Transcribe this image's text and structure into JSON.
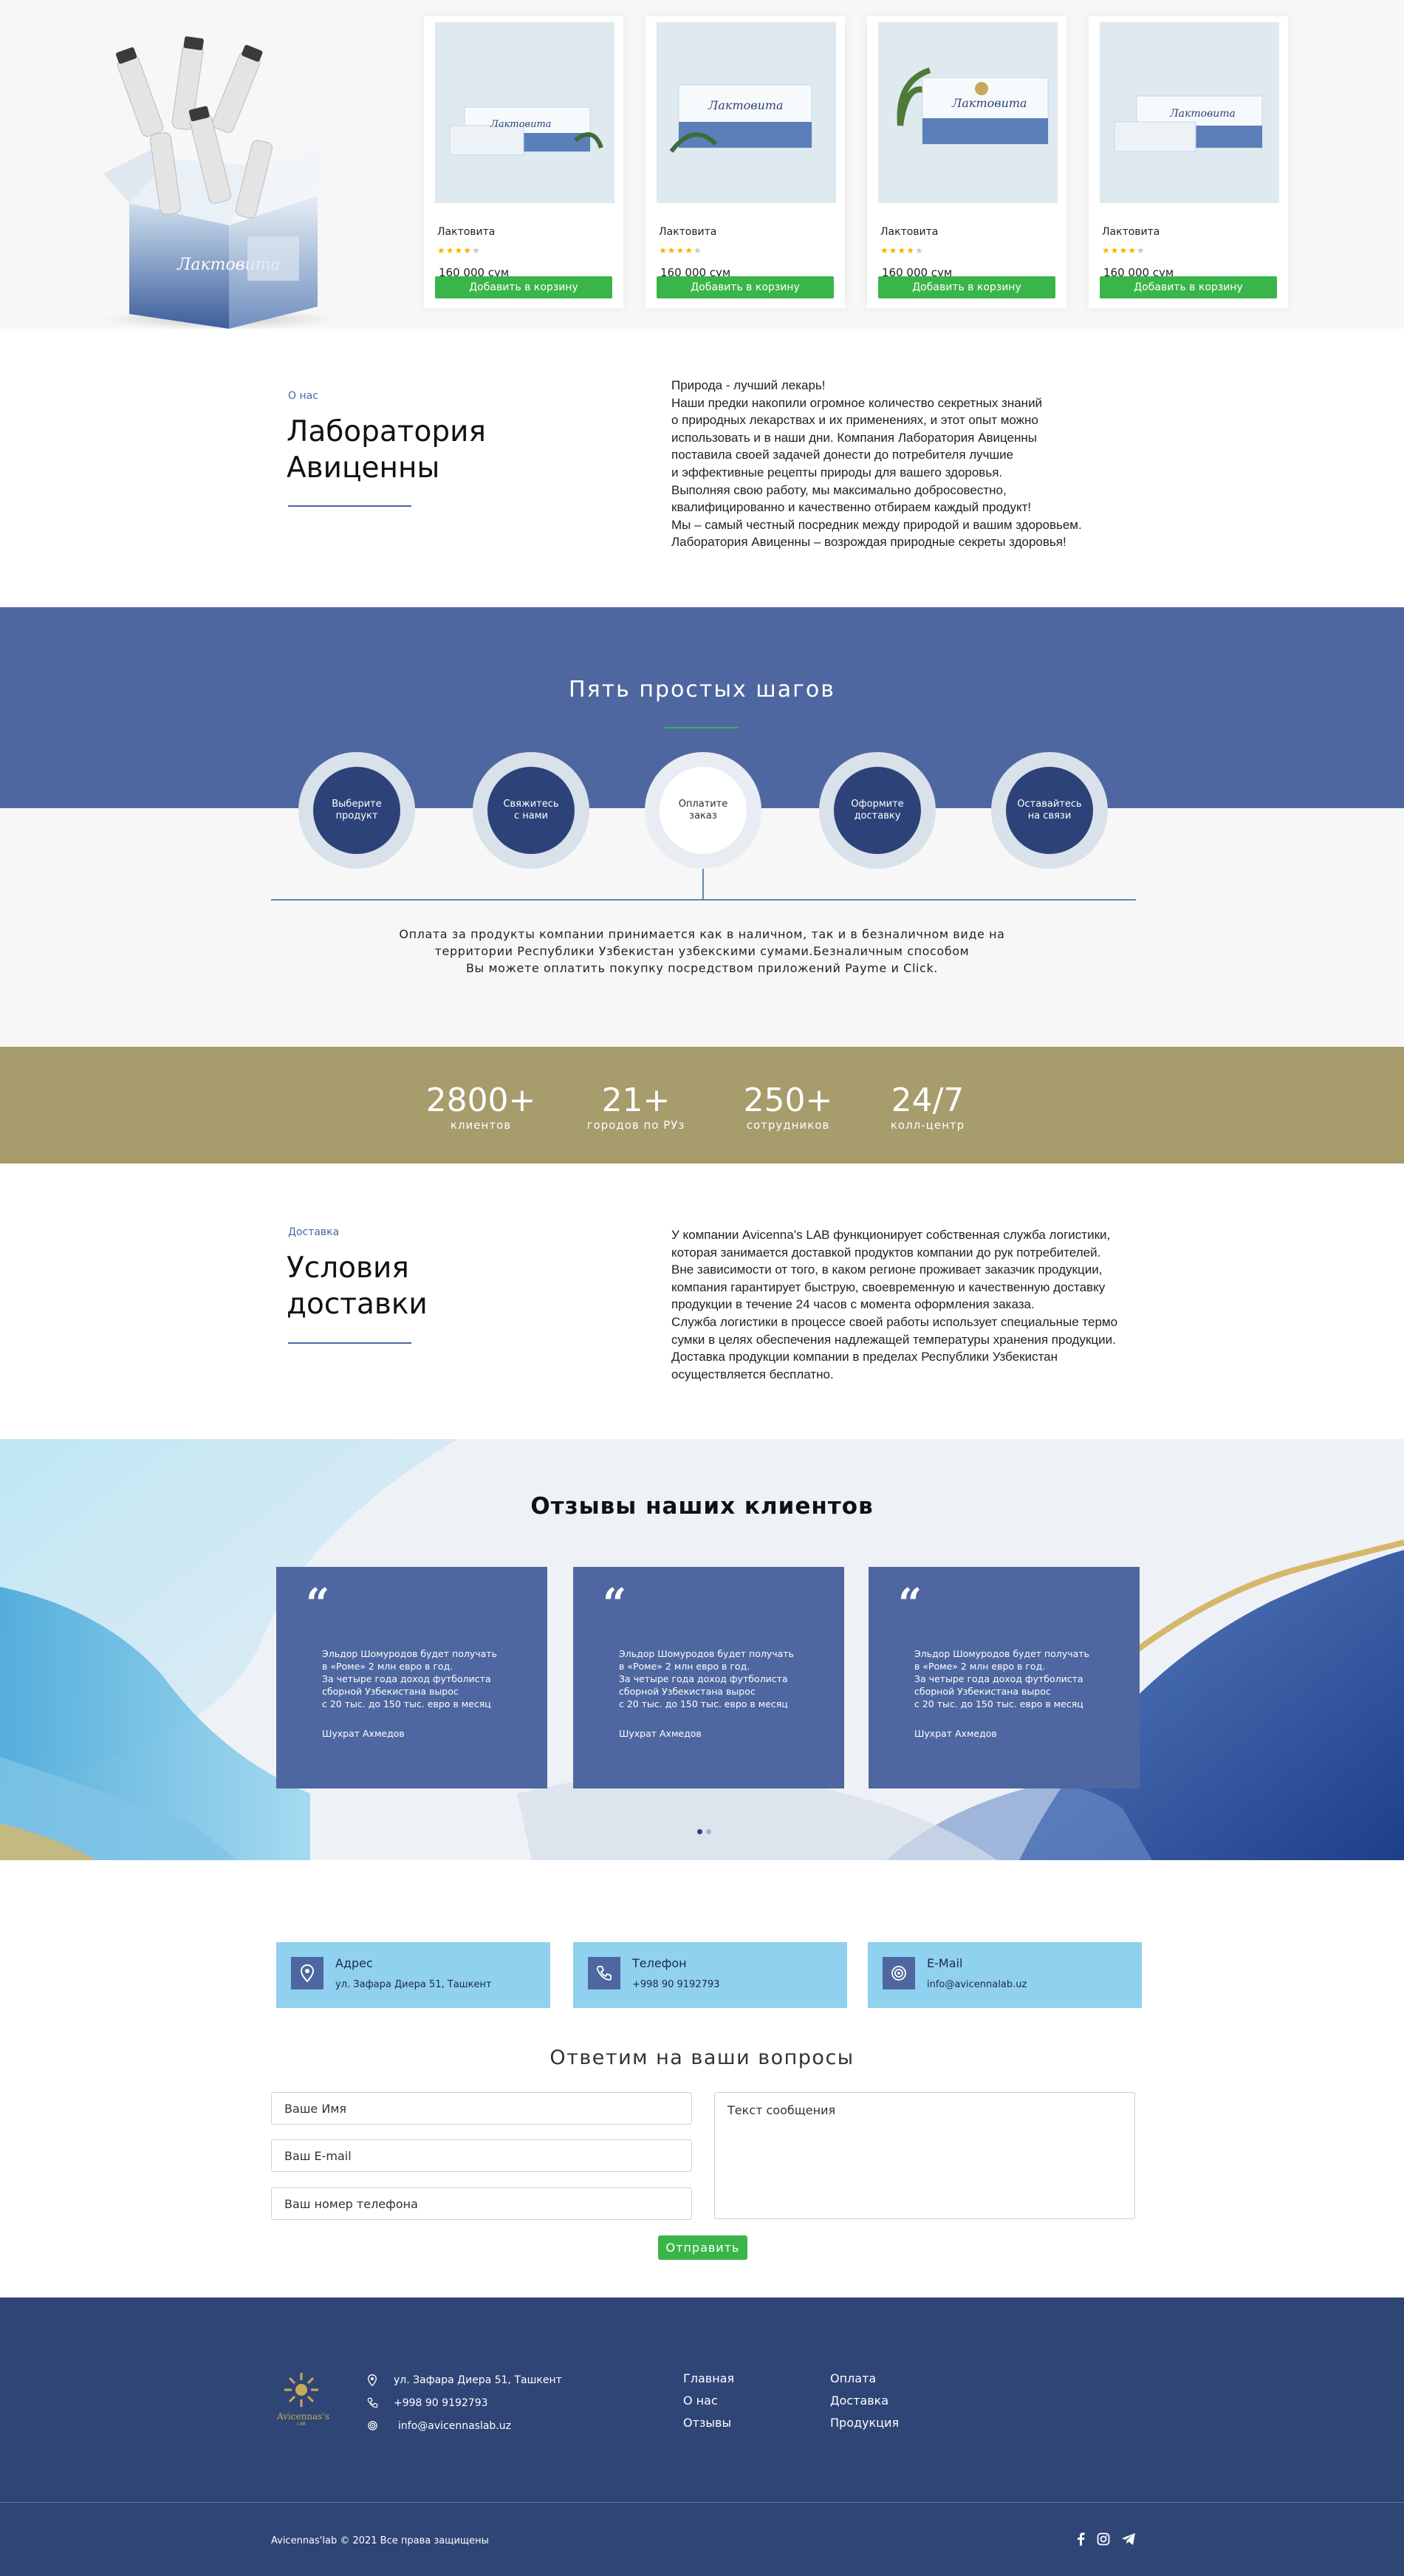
{
  "products": [
    {
      "name": "Лактовита",
      "rating": 4,
      "price": "160 000 сум",
      "button": "Добавить в корзину"
    },
    {
      "name": "Лактовита",
      "rating": 4,
      "price": "160 000 сум",
      "button": "Добавить в корзину"
    },
    {
      "name": "Лактовита",
      "rating": 4,
      "price": "160 000 сум",
      "button": "Добавить в корзину"
    },
    {
      "name": "Лактовита",
      "rating": 4,
      "price": "160 000 сум",
      "button": "Добавить в корзину"
    }
  ],
  "about": {
    "kicker": "О нас",
    "title": "Лаборатория\nАвиценны",
    "text": "Природа - лучший лекарь!\nНаши предки накопили огромное количество секретных знаний\nо природных лекарствах и их применениях, и этот опыт можно\nиспользовать и в наши дни. Компания Лаборатория Авиценны\nпоставила своей задачей донести до потребителя лучшие\nи эффективные рецепты природы для вашего здоровья.\nВыполняя свою работу, мы максимально добросовестно,\nквалифицированно и качественно отбираем каждый продукт!\nМы – самый честный посредник между природой и вашим здоровьем.\nЛаборатория Авиценны – возрождая природные секреты здоровья!"
  },
  "steps": {
    "title": "Пять простых шагов",
    "items": [
      "Выберите\nпродукт",
      "Свяжитесь\nс нами",
      "Оплатите\nзаказ",
      "Оформите\nдоставку",
      "Оставайтесь\nна связи"
    ],
    "active_index": 2,
    "description": "Оплата за продукты компании принимается как в наличном, так и в безналичном виде на\nтерритории Республики Узбекистан узбекскими сумами.Безналичным способом\nВы можете оплатить покупку посредством приложений Payme и Click."
  },
  "stats": [
    {
      "value": "2800+",
      "label": "клиентов"
    },
    {
      "value": "21+",
      "label": "городов по РУз"
    },
    {
      "value": "250+",
      "label": "сотрудников"
    },
    {
      "value": "24/7",
      "label": "колл-центр"
    }
  ],
  "delivery": {
    "kicker": "Доставка",
    "title": "Условия\nдоставки",
    "text": "У компании Avicenna’s LAB функционирует собственная служба логистики,\nкоторая занимается доставкой продуктов компании до рук потребителей.\nВне зависимости от того, в каком регионе проживает заказчик продукции,\nкомпания гарантирует быструю, своевременную и качественную доставку\nпродукции в течение 24 часов с момента оформления заказа.\nСлужба логистики в процессе своей работы использует специальные термо\nсумки в целях обеспечения надлежащей температуры хранения продукции.\nДоставка продукции компании в пределах Республики Узбекистан\nосуществляется бесплатно."
  },
  "reviews": {
    "title": "Отзывы наших клиентов",
    "quote_mark": "“",
    "items": [
      {
        "text": "Эльдор Шомуродов будет получать\nв «Роме» 2 млн евро в год.\nЗа четыре года доход футболиста\nсборной Узбекистана вырос\nс 20 тыс. до 150 тыс. евро в месяц",
        "author": "Шухрат Ахмедов"
      },
      {
        "text": "Эльдор Шомуродов будет получать\nв «Роме» 2 млн евро в год.\nЗа четыре года доход футболиста\nсборной Узбекистана вырос\nс 20 тыс. до 150 тыс. евро в месяц",
        "author": "Шухрат Ахмедов"
      },
      {
        "text": "Эльдор Шомуродов будет получать\nв «Роме» 2 млн евро в год.\nЗа четыре года доход футболиста\nсборной Узбекистана вырос\nс 20 тыс. до 150 тыс. евро в месяц",
        "author": "Шухрат Ахмедов"
      }
    ]
  },
  "contacts": [
    {
      "title": "Адрес",
      "value": "ул. Зафара Диера 51, Ташкент",
      "icon": "location-pin-icon"
    },
    {
      "title": "Телефон",
      "value": "+998 90 9192793",
      "icon": "phone-icon"
    },
    {
      "title": "E-Mail",
      "value": "info@avicennalab.uz",
      "icon": "at-icon"
    }
  ],
  "form": {
    "title": "Ответим на ваши вопросы",
    "name_placeholder": "Ваше Имя",
    "email_placeholder": "Ваш E-mail",
    "phone_placeholder": "Ваш номер телефона",
    "message_placeholder": "Текст сообщения",
    "submit": "Отправить"
  },
  "footer": {
    "logo_text": "Avicennas's",
    "logo_sub": "LAB",
    "address": "ул. Зафара Диера 51, Ташкент",
    "phone": "+998 90 9192793",
    "email": "info@avicennaslab.uz",
    "links_col1": [
      "Главная",
      "О нас",
      "Отзывы"
    ],
    "links_col2": [
      "Оплата",
      "Доставка",
      "Продукция"
    ],
    "copyright": "Avicennas'lab © 2021 Все права защищены",
    "social_icons": [
      "facebook-icon",
      "instagram-icon",
      "telegram-icon"
    ]
  },
  "colors": {
    "primary_blue": "#4f67a0",
    "dark_blue": "#2f4576",
    "green": "#3ab54a",
    "gold": "#a69c6c",
    "light_blue": "#8fd1ee"
  }
}
